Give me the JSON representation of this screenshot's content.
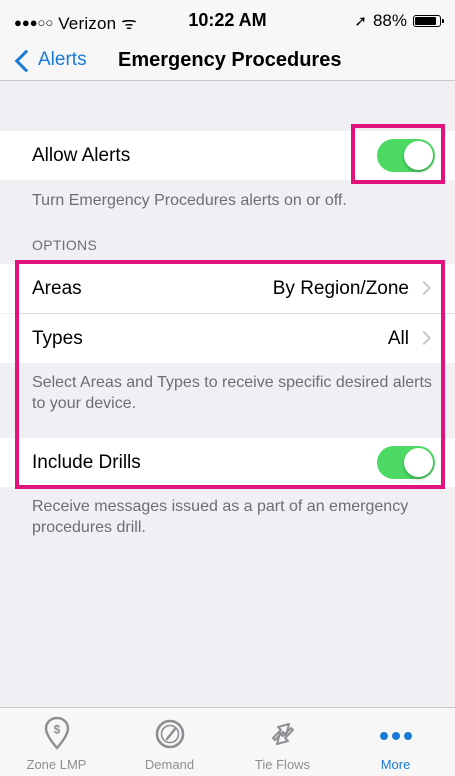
{
  "status_bar": {
    "signal_dots": "●●●○○",
    "carrier": "Verizon",
    "wifi_glyph": "ᯤ",
    "time": "10:22 AM",
    "location_glyph": "➚",
    "battery": "88%"
  },
  "nav": {
    "back_label": "Alerts",
    "title": "Emergency Procedures"
  },
  "allow_alerts": {
    "label": "Allow Alerts",
    "enabled": true,
    "footer": "Turn Emergency Procedures alerts on or off."
  },
  "options": {
    "header": "OPTIONS",
    "areas": {
      "label": "Areas",
      "value": "By Region/Zone"
    },
    "types": {
      "label": "Types",
      "value": "All"
    },
    "footer": "Select Areas and Types to receive specific desired alerts to your device."
  },
  "drills": {
    "label": "Include Drills",
    "enabled": true,
    "footer": "Receive messages issued as a part of an emergency procedures drill."
  },
  "tabs": [
    {
      "label": "Zone LMP",
      "icon": "dollar-pin-icon",
      "active": false
    },
    {
      "label": "Demand",
      "icon": "gauge-icon",
      "active": false
    },
    {
      "label": "Tie Flows",
      "icon": "arrows-icon",
      "active": false
    },
    {
      "label": "More",
      "icon": "more-dots-icon",
      "active": true
    }
  ],
  "colors": {
    "accent": "#1a7bd6",
    "toggle_on": "#4cd964",
    "highlight": "#e0147c",
    "background": "#efeff4"
  }
}
